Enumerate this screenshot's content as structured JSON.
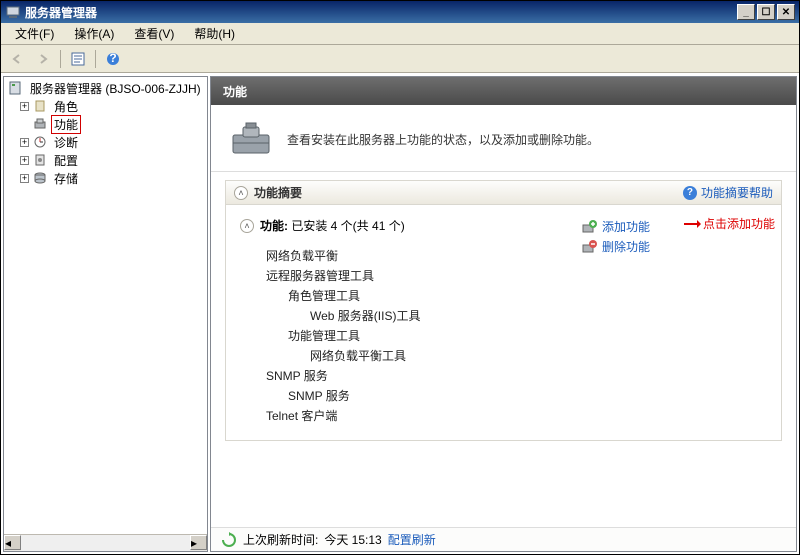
{
  "window": {
    "title": "服务器管理器"
  },
  "menu": {
    "file": "文件(F)",
    "action": "操作(A)",
    "view": "查看(V)",
    "help": "帮助(H)"
  },
  "tree": {
    "root": "服务器管理器 (BJSO-006-ZJJH)",
    "roles": "角色",
    "features": "功能",
    "diagnostics": "诊断",
    "config": "配置",
    "storage": "存储"
  },
  "header": {
    "title": "功能"
  },
  "info": {
    "text": "查看安装在此服务器上功能的状态，以及添加或删除功能。"
  },
  "panel": {
    "title": "功能摘要",
    "help": "功能摘要帮助",
    "count_prefix": "功能:",
    "count_value": "已安装 4 个(共 41 个)",
    "items": {
      "nlb": "网络负载平衡",
      "rsat": "远程服务器管理工具",
      "roletools": "角色管理工具",
      "iistools": "Web 服务器(IIS)工具",
      "feattools": "功能管理工具",
      "nlbtools": "网络负载平衡工具",
      "snmp": "SNMP 服务",
      "snmpsvc": "SNMP 服务",
      "telnet": "Telnet 客户端"
    },
    "actions": {
      "add": "添加功能",
      "remove": "删除功能"
    },
    "annotation": "点击添加功能"
  },
  "status": {
    "prefix": "上次刷新时间:",
    "time": "今天 15:13",
    "link": "配置刷新"
  }
}
